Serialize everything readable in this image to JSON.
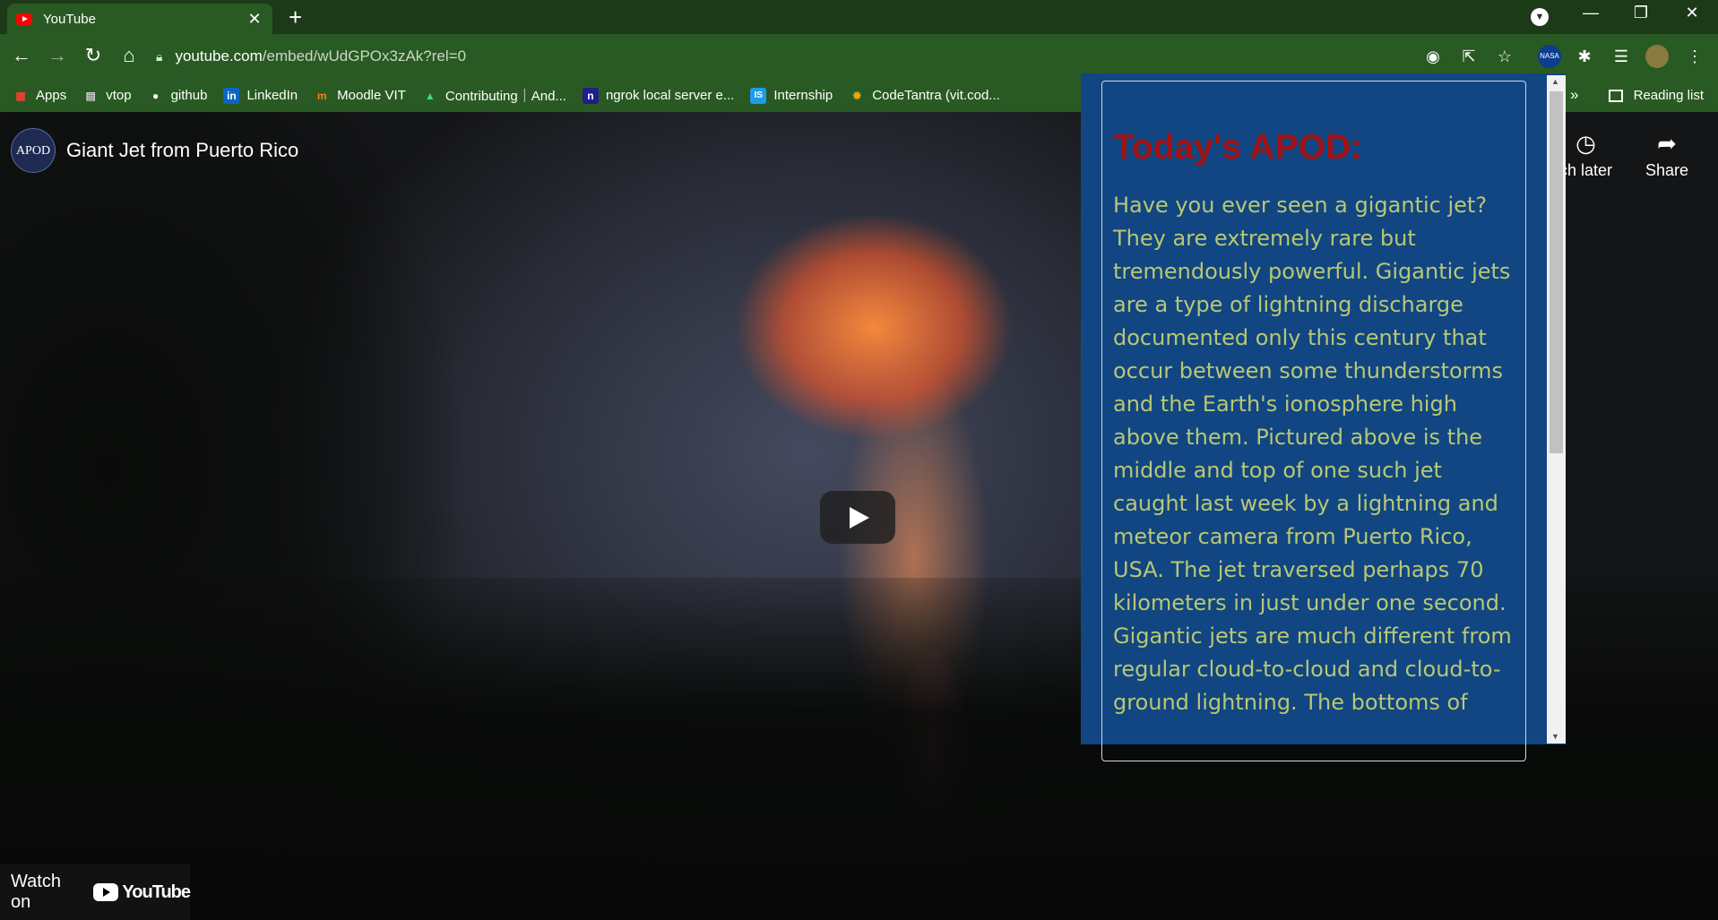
{
  "browser": {
    "tab": {
      "title": "YouTube",
      "close": "✕"
    },
    "new_tab": "+",
    "window_controls": {
      "minimize": "—",
      "restore": "❐",
      "close": "✕"
    },
    "url": {
      "domain": "youtube.com",
      "path": "/embed/wUdGPOx3zAk?rel=0"
    },
    "nav": {
      "back": "←",
      "forward": "→",
      "reload": "↻",
      "home": "⌂"
    },
    "toolbar_icons": {
      "nasa_label": "NASA",
      "extensions": "✱",
      "media": "☰",
      "menu": "⋮"
    }
  },
  "bookmarks": {
    "items": [
      {
        "label": "Apps",
        "icon": "apps-grid-icon",
        "color": "#ea4335",
        "glyph": "▦"
      },
      {
        "label": "vtop",
        "icon": "vtop-icon",
        "color": "#d0d0d0",
        "glyph": "▤"
      },
      {
        "label": "github",
        "icon": "github-icon",
        "color": "#ffffff",
        "glyph": "●"
      },
      {
        "label": "LinkedIn",
        "icon": "linkedin-icon",
        "color": "#0a66c2",
        "glyph": "in"
      },
      {
        "label": "Moodle VIT",
        "icon": "moodle-icon",
        "color": "#f98012",
        "glyph": "m"
      },
      {
        "label": "Contributing｜And...",
        "icon": "android-icon",
        "color": "#3ddc84",
        "glyph": "▲"
      },
      {
        "label": "ngrok local server e...",
        "icon": "ngrok-icon",
        "color": "#1f1e37",
        "glyph": "n"
      },
      {
        "label": "Internship",
        "icon": "internship-icon",
        "color": "#1e9ce8",
        "glyph": "IS"
      },
      {
        "label": "CodeTantra (vit.cod...",
        "icon": "codetantra-icon",
        "color": "#f2a900",
        "glyph": "✹"
      }
    ],
    "overflow": "»",
    "reading_list": "Reading list"
  },
  "video": {
    "channel_logo": "APOD",
    "title": "Giant Jet from Puerto Rico",
    "watch_later": "ch later",
    "share": "Share",
    "watch_on": "Watch on",
    "youtube_wordmark": "YouTube"
  },
  "popup": {
    "heading": "Today's APOD:",
    "body": "Have you ever seen a gigantic jet? They are extremely rare but tremendously powerful. Gigantic jets are a type of lightning discharge documented only this century that occur between some thunderstorms and the Earth's ionosphere high above them. Pictured above is the middle and top of one such jet caught last week by a lightning and meteor camera from Puerto Rico, USA. The jet traversed perhaps 70 kilometers in just under one second. Gigantic jets are much different from regular cloud-to-cloud and cloud-to-ground lightning. The bottoms of"
  }
}
